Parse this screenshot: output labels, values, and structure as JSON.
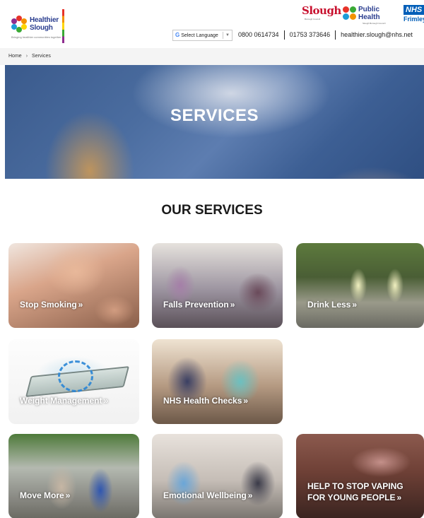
{
  "header": {
    "logo_line1": "Healthier",
    "logo_line2": "Slough",
    "logo_tagline": "Bringing healthier communities together",
    "partner1": "Slough",
    "partner1_sub": "Borough Council",
    "partner2_line1": "Public",
    "partner2_line2": "Health",
    "partner2_sub": "Slough Borough Council",
    "partner3_badge": "NHS",
    "partner3_name": "Frimley",
    "language_label": "Select Language",
    "phone1": "0800 0614734",
    "phone2": "01753 373646",
    "email": "healthier.slough@nhs.net"
  },
  "breadcrumb": {
    "home": "Home",
    "current": "Services",
    "separator": "›"
  },
  "hero": {
    "title": "SERVICES"
  },
  "section_title": "OUR SERVICES",
  "cards": [
    {
      "label": "Stop Smoking",
      "chevron": "»"
    },
    {
      "label": "Falls Prevention",
      "chevron": "»"
    },
    {
      "label": "Drink Less",
      "chevron": "»"
    },
    {
      "label": "Weight Management",
      "chevron": "»"
    },
    {
      "label": "NHS Health Checks",
      "chevron": "»"
    },
    {
      "label": "Move More",
      "chevron": "»"
    },
    {
      "label": "Emotional Wellbeing",
      "chevron": "»"
    },
    {
      "label_line1": "HELP TO STOP VAPING",
      "label_line2": "FOR YOUNG PEOPLE",
      "chevron": "»"
    }
  ],
  "colors": {
    "brand_blue": "#2a3d8f",
    "slough_red": "#c8102e",
    "nhs_blue": "#005eb8"
  }
}
